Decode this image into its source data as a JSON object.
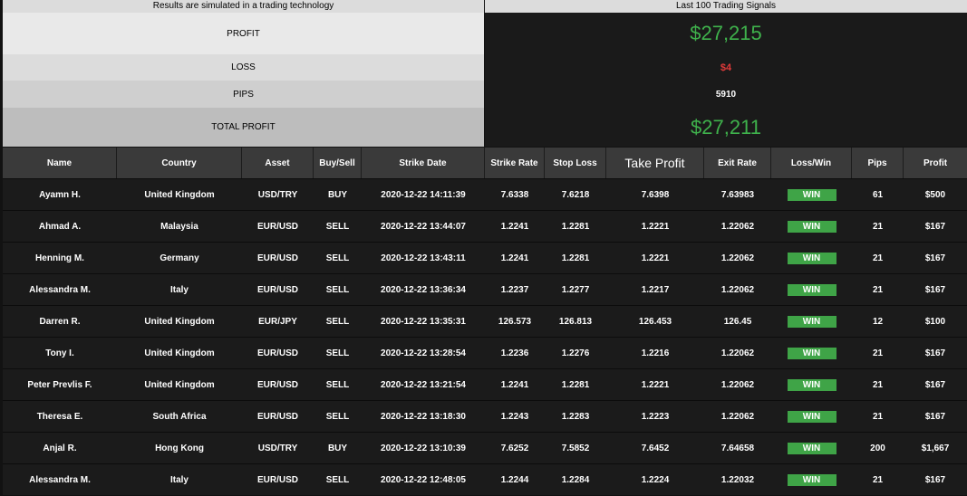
{
  "summary": {
    "left_caption": "Results are simulated in a trading technology",
    "right_caption": "Last 100 Trading Signals",
    "rows": [
      {
        "label": "PROFIT",
        "value": "$27,215"
      },
      {
        "label": "LOSS",
        "value": "$4"
      },
      {
        "label": "PIPS",
        "value": "5910"
      },
      {
        "label": "TOTAL PROFIT",
        "value": "$27,211"
      }
    ],
    "colors": {
      "positive": "#3fb24c",
      "negative": "#e03a3a"
    }
  },
  "table": {
    "headers": [
      "Name",
      "Country",
      "Asset",
      "Buy/Sell",
      "Strike Date",
      "Strike Rate",
      "Stop Loss",
      "Take Profit",
      "Exit Rate",
      "Loss/Win",
      "Pips",
      "Profit"
    ],
    "rows": [
      [
        "Ayamn H.",
        "United Kingdom",
        "USD/TRY",
        "BUY",
        "2020-12-22 14:11:39",
        "7.6338",
        "7.6218",
        "7.6398",
        "7.63983",
        "WIN",
        "61",
        "$500"
      ],
      [
        "Ahmad A.",
        "Malaysia",
        "EUR/USD",
        "SELL",
        "2020-12-22 13:44:07",
        "1.2241",
        "1.2281",
        "1.2221",
        "1.22062",
        "WIN",
        "21",
        "$167"
      ],
      [
        "Henning M.",
        "Germany",
        "EUR/USD",
        "SELL",
        "2020-12-22 13:43:11",
        "1.2241",
        "1.2281",
        "1.2221",
        "1.22062",
        "WIN",
        "21",
        "$167"
      ],
      [
        "Alessandra M.",
        "Italy",
        "EUR/USD",
        "SELL",
        "2020-12-22 13:36:34",
        "1.2237",
        "1.2277",
        "1.2217",
        "1.22062",
        "WIN",
        "21",
        "$167"
      ],
      [
        "Darren R.",
        "United Kingdom",
        "EUR/JPY",
        "SELL",
        "2020-12-22 13:35:31",
        "126.573",
        "126.813",
        "126.453",
        "126.45",
        "WIN",
        "12",
        "$100"
      ],
      [
        "Tony I.",
        "United Kingdom",
        "EUR/USD",
        "SELL",
        "2020-12-22 13:28:54",
        "1.2236",
        "1.2276",
        "1.2216",
        "1.22062",
        "WIN",
        "21",
        "$167"
      ],
      [
        "Peter Prevlis F.",
        "United Kingdom",
        "EUR/USD",
        "SELL",
        "2020-12-22 13:21:54",
        "1.2241",
        "1.2281",
        "1.2221",
        "1.22062",
        "WIN",
        "21",
        "$167"
      ],
      [
        "Theresa E.",
        "South Africa",
        "EUR/USD",
        "SELL",
        "2020-12-22 13:18:30",
        "1.2243",
        "1.2283",
        "1.2223",
        "1.22062",
        "WIN",
        "21",
        "$167"
      ],
      [
        "Anjal R.",
        "Hong Kong",
        "USD/TRY",
        "BUY",
        "2020-12-22 13:10:39",
        "7.6252",
        "7.5852",
        "7.6452",
        "7.64658",
        "WIN",
        "200",
        "$1,667"
      ],
      [
        "Alessandra M.",
        "Italy",
        "EUR/USD",
        "SELL",
        "2020-12-22 12:48:05",
        "1.2244",
        "1.2284",
        "1.2224",
        "1.22032",
        "WIN",
        "21",
        "$167"
      ]
    ],
    "win_color": "#3fa447"
  }
}
